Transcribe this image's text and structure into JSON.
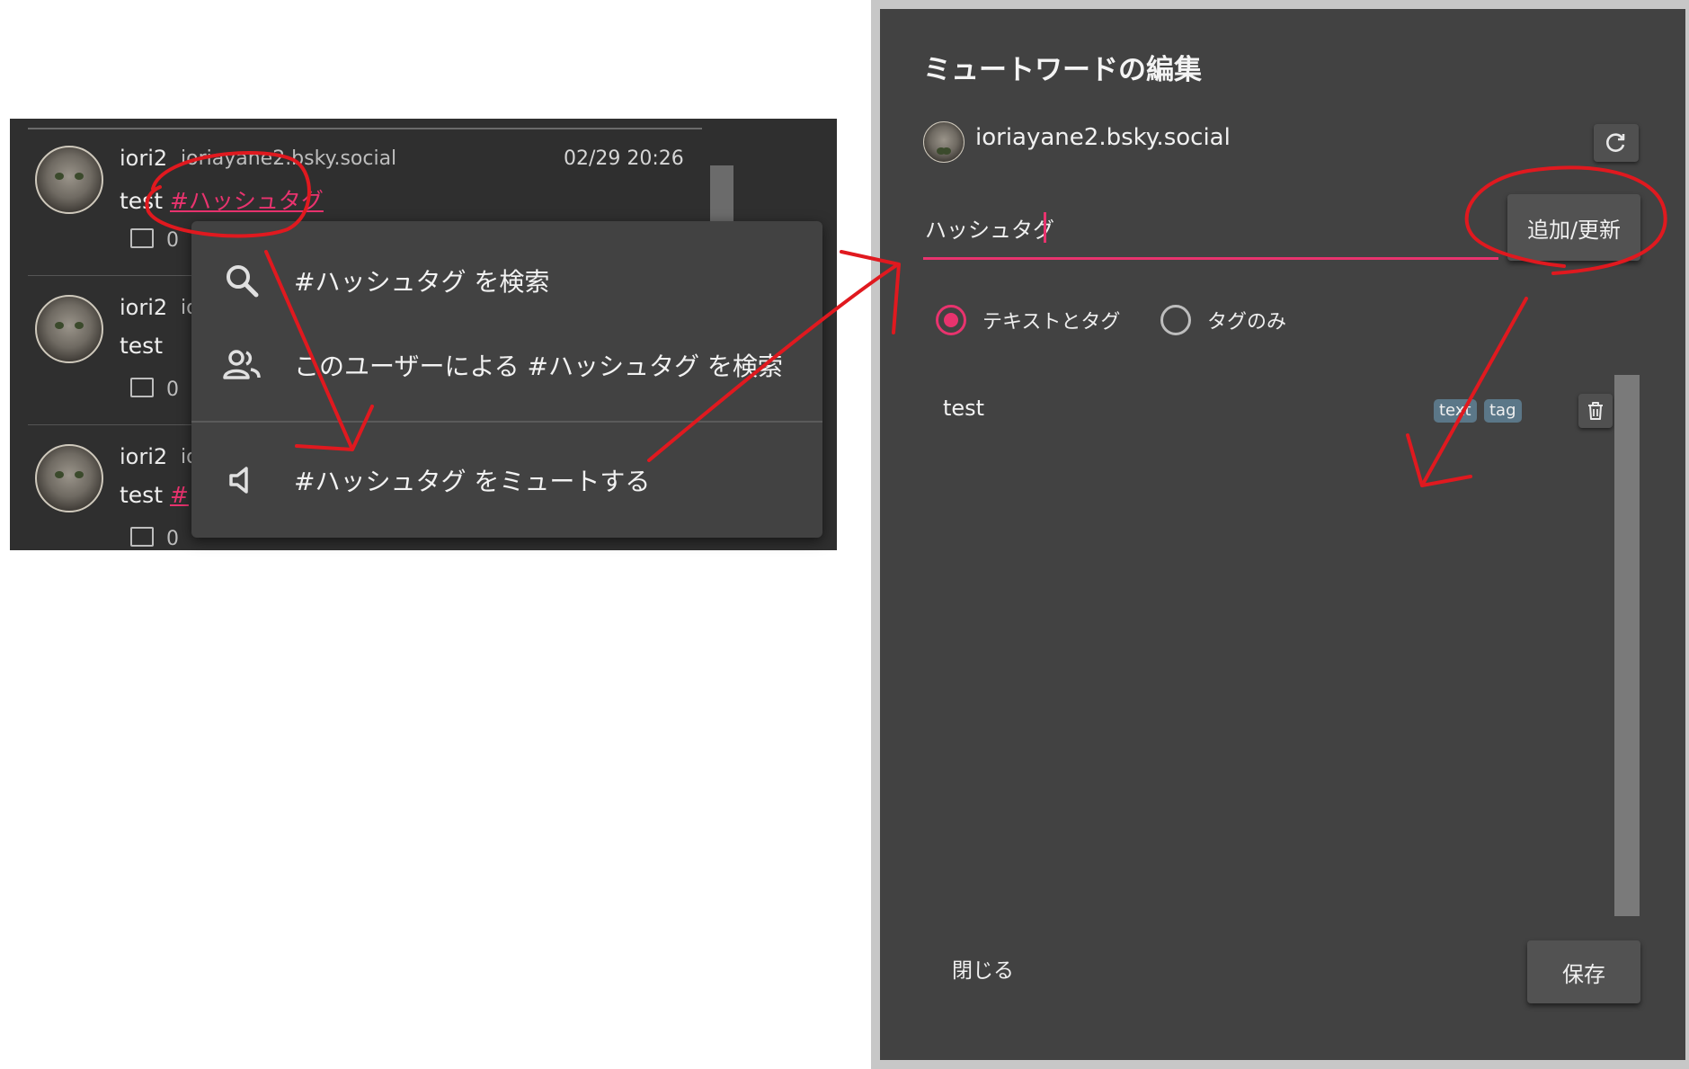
{
  "timeline": {
    "posts": [
      {
        "name": "iori2",
        "handle": "ioriayane2.bsky.social",
        "time": "02/29 20:26",
        "text": "test",
        "tag": "#ハッシュタグ",
        "reply_count": "0"
      },
      {
        "name": "iori2",
        "handle": "io",
        "time": "",
        "text": "test",
        "tag": "",
        "reply_count": "0"
      },
      {
        "name": "iori2",
        "handle": "io",
        "time": "",
        "text": "test",
        "tag": "#",
        "reply_count": "0"
      }
    ]
  },
  "context_menu": {
    "items": [
      {
        "icon": "search-icon",
        "label": "#ハッシュタグ を検索"
      },
      {
        "icon": "users-icon",
        "label": "このユーザーによる #ハッシュタグ を検索"
      },
      {
        "icon": "mute-speaker-icon",
        "label": "#ハッシュタグ をミュートする"
      }
    ]
  },
  "dialog": {
    "title": "ミュートワードの編集",
    "account": "ioriayane2.bsky.social",
    "input_value": "ハッシュタグ",
    "add_button": "追加/更新",
    "radio_options": [
      {
        "label": "テキストとタグ",
        "selected": true
      },
      {
        "label": "タグのみ",
        "selected": false
      }
    ],
    "words": [
      {
        "word": "test",
        "badges": [
          "text",
          "tag"
        ]
      }
    ],
    "close_button": "閉じる",
    "save_button": "保存"
  },
  "colors": {
    "accent": "#e8336e",
    "panel": "#424242",
    "timeline_bg": "#2f2f2f",
    "badge": "#5b7788",
    "annotation": "#e0191f"
  }
}
